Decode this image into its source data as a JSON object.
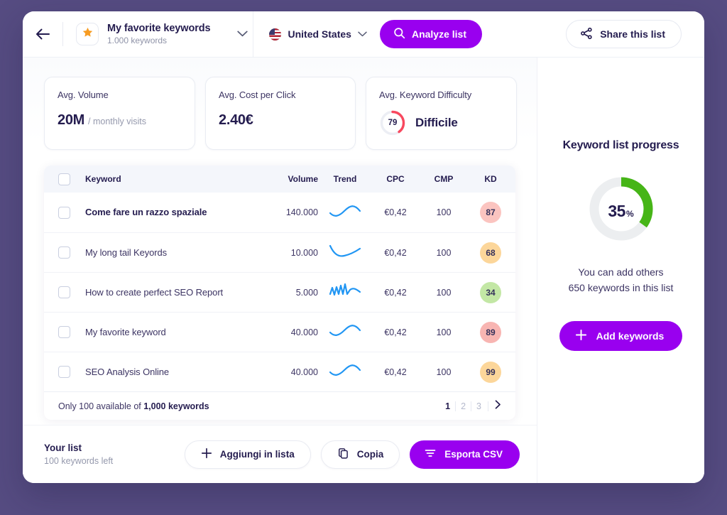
{
  "header": {
    "back_icon": "arrow-left-icon",
    "star_icon": "star-icon",
    "list_title": "My favorite keywords",
    "list_subtitle": "1.000 keywords",
    "dropdown_icon": "chevron-down-icon",
    "country": "United States",
    "country_flag_icon": "us-flag-icon",
    "country_chevron_icon": "chevron-down-icon",
    "analyze_label": "Analyze list",
    "analyze_icon": "search-icon",
    "share_label": "Share this list",
    "share_icon": "share-icon"
  },
  "stats": [
    {
      "label": "Avg. Volume",
      "value": "20M",
      "unit": "/ monthly visits"
    },
    {
      "label": "Avg. Cost per Click",
      "value": "2.40€",
      "unit": ""
    },
    {
      "label": "Avg. Keyword Difficulty",
      "gauge_value": "79",
      "gauge_percent": 40,
      "word": "Difficile",
      "gauge_color": "#f8485e",
      "gauge_track": "#eceef4"
    }
  ],
  "table": {
    "select_all_icon": "checkbox-icon",
    "columns": [
      "Keyword",
      "Volume",
      "Trend",
      "CPC",
      "CMP",
      "KD"
    ],
    "rows": [
      {
        "keyword": "Come fare un razzo spaziale",
        "bold": true,
        "volume": "140.000",
        "trend": "wave-up",
        "cpc": "€0,42",
        "cmp": "100",
        "kd": "87",
        "kd_color": "#fbc4c0"
      },
      {
        "keyword": "My long tail Keyords",
        "bold": false,
        "volume": "10.000",
        "trend": "dip-up",
        "cpc": "€0,42",
        "cmp": "100",
        "kd": "68",
        "kd_color": "#fcd69a"
      },
      {
        "keyword": "How to create perfect SEO Report",
        "bold": false,
        "volume": "5.000",
        "trend": "zigzag",
        "cpc": "€0,42",
        "cmp": "100",
        "kd": "34",
        "kd_color": "#c3e7a5"
      },
      {
        "keyword": "My favorite keyword",
        "bold": false,
        "volume": "40.000",
        "trend": "wave-up",
        "cpc": "€0,42",
        "cmp": "100",
        "kd": "89",
        "kd_color": "#f8b5b2"
      },
      {
        "keyword": "SEO Analysis Online",
        "bold": false,
        "volume": "40.000",
        "trend": "wave-up",
        "cpc": "€0,42",
        "cmp": "100",
        "kd": "99",
        "kd_color": "#fcd69a"
      }
    ],
    "footer_prefix": "Only 100 available of ",
    "footer_bold": "1,000 keywords",
    "pages": [
      "1",
      "2",
      "3"
    ],
    "active_page": "1",
    "next_icon": "chevron-right-icon"
  },
  "bottombar": {
    "title": "Your list",
    "subtitle": "100 keywords left",
    "add_to_list_label": "Aggiungi in lista",
    "add_to_list_icon": "plus-icon",
    "copy_label": "Copia",
    "copy_icon": "copy-icon",
    "export_label": "Esporta CSV",
    "export_icon": "filter-icon"
  },
  "sidebar": {
    "title": "Keyword list progress",
    "progress_value": "35",
    "progress_symbol": "%",
    "progress_percent": 35,
    "progress_color": "#46b517",
    "progress_track": "#eceef0",
    "note_line1": "You can add others",
    "note_line2": "650 keywords in this list",
    "add_keywords_label": "Add keywords",
    "add_keywords_icon": "plus-icon"
  },
  "colors": {
    "accent": "#9900ef",
    "page_background": "#564c82",
    "text_dark": "#241c4f",
    "sparkline": "#2196f3"
  }
}
